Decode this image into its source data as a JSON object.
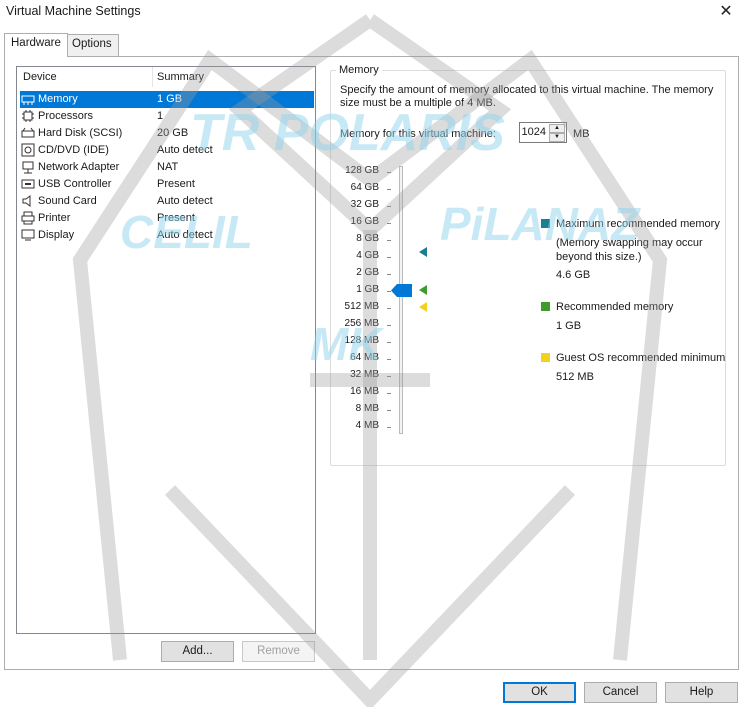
{
  "window": {
    "title": "Virtual Machine Settings"
  },
  "tabs": [
    {
      "label": "Hardware"
    },
    {
      "label": "Options"
    }
  ],
  "device_list": {
    "headers": {
      "device": "Device",
      "summary": "Summary"
    },
    "rows": [
      {
        "device": "Memory",
        "summary": "1 GB",
        "icon": "memory-icon"
      },
      {
        "device": "Processors",
        "summary": "1",
        "icon": "processor-icon"
      },
      {
        "device": "Hard Disk (SCSI)",
        "summary": "20 GB",
        "icon": "hard-disk-icon"
      },
      {
        "device": "CD/DVD (IDE)",
        "summary": "Auto detect",
        "icon": "cd-dvd-icon"
      },
      {
        "device": "Network Adapter",
        "summary": "NAT",
        "icon": "network-adapter-icon"
      },
      {
        "device": "USB Controller",
        "summary": "Present",
        "icon": "usb-icon"
      },
      {
        "device": "Sound Card",
        "summary": "Auto detect",
        "icon": "sound-card-icon"
      },
      {
        "device": "Printer",
        "summary": "Present",
        "icon": "printer-icon"
      },
      {
        "device": "Display",
        "summary": "Auto detect",
        "icon": "display-icon"
      }
    ]
  },
  "list_buttons": {
    "add": "Add...",
    "remove": "Remove"
  },
  "memory": {
    "group_label": "Memory",
    "description": "Specify the amount of memory allocated to this virtual machine. The memory size must be a multiple of 4 MB.",
    "field_label": "Memory for this virtual machine:",
    "value": "1024",
    "unit": "MB",
    "scale": [
      "128 GB",
      "64 GB",
      "32 GB",
      "16 GB",
      "8 GB",
      "4 GB",
      "2 GB",
      "1 GB",
      "512 MB",
      "256 MB",
      "128 MB",
      "64 MB",
      "32 MB",
      "16 MB",
      "8 MB",
      "4 MB"
    ],
    "legend": {
      "max": {
        "label": "Maximum recommended memory",
        "note": "(Memory swapping may occur beyond this size.)",
        "value": "4.6 GB",
        "color": "#1a7f8f"
      },
      "recommended": {
        "label": "Recommended memory",
        "value": "1 GB",
        "color": "#3f9b2c"
      },
      "guest_min": {
        "label": "Guest OS recommended minimum",
        "value": "512 MB",
        "color": "#f2d21b"
      }
    },
    "slider_color": "#0078d7"
  },
  "footer_buttons": {
    "ok": "OK",
    "cancel": "Cancel",
    "help": "Help"
  },
  "watermark": {
    "line1": "TR POLARIS",
    "line2_left": "CELIL",
    "line2_right": "PiLANAZ",
    "line3": "MK"
  }
}
